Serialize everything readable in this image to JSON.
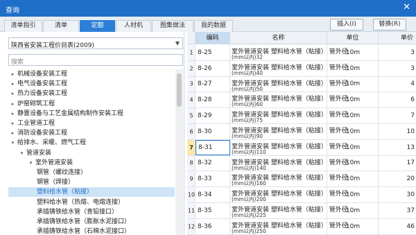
{
  "window": {
    "title": "查询",
    "close": "✕"
  },
  "tabs": [
    "清单指引",
    "清单",
    "定额",
    "人材机",
    "图集做法",
    "我的数据"
  ],
  "buttons": {
    "insert": "插入(I)",
    "replace": "替换(R)"
  },
  "library": {
    "selected": "陕西省安装工程价目表(2009)",
    "options_icon": "chevron-down-icon"
  },
  "search": {
    "placeholder": "搜索",
    "value": ""
  },
  "tree": [
    {
      "label": "机械设备安装工程",
      "twisty": "▸",
      "level": 0
    },
    {
      "label": "电气设备安装工程",
      "twisty": "▸",
      "level": 0
    },
    {
      "label": "热力设备安装工程",
      "twisty": "▸",
      "level": 0
    },
    {
      "label": "炉窑砌筑工程",
      "twisty": "▸",
      "level": 0
    },
    {
      "label": "静置设备与工艺金属结构制作安装工程",
      "twisty": "▸",
      "level": 0
    },
    {
      "label": "工业管道工程",
      "twisty": "▸",
      "level": 0
    },
    {
      "label": "消防设备安装工程",
      "twisty": "▸",
      "level": 0
    },
    {
      "label": "给排水、采暖、燃气工程",
      "twisty": "▾",
      "level": 0
    },
    {
      "label": "管道安装",
      "twisty": "▾",
      "level": 1
    },
    {
      "label": "室外管道安装",
      "twisty": "▾",
      "level": 2
    },
    {
      "label": "钢管（螺纹连接）",
      "twisty": "",
      "level": 3
    },
    {
      "label": "钢管（焊接）",
      "twisty": "",
      "level": 3
    },
    {
      "label": "塑料给水管（粘接）",
      "twisty": "",
      "level": 3,
      "selected": true
    },
    {
      "label": "塑料给水管（热熔、电熔连接）",
      "twisty": "",
      "level": 3
    },
    {
      "label": "承插铸铁给水管（青铅接口）",
      "twisty": "",
      "level": 3
    },
    {
      "label": "承插铸铁给水管（膨胀水泥接口）",
      "twisty": "",
      "level": 3
    },
    {
      "label": "承插铸铁给水管（石棉水泥接口）",
      "twisty": "",
      "level": 3
    },
    {
      "label": "承插铸铁给水管（胶圈接口）",
      "twisty": "",
      "level": 3
    }
  ],
  "grid": {
    "headers": {
      "code": "编码",
      "name": "名称",
      "unit": "单位",
      "price": "单价"
    },
    "current_row": 7,
    "rows": [
      {
        "n": "1",
        "code": "8-25",
        "name": "室外管道安装 塑料给水管（粘接） 管外径",
        "spec": "(mm以内)32",
        "unit": "10m",
        "price": "3"
      },
      {
        "n": "2",
        "code": "8-26",
        "name": "室外管道安装 塑料给水管（粘接） 管外径",
        "spec": "(mm以内)40",
        "unit": "10m",
        "price": "3"
      },
      {
        "n": "3",
        "code": "8-27",
        "name": "室外管道安装 塑料给水管（粘接） 管外径",
        "spec": "(mm以内)50",
        "unit": "10m",
        "price": "4"
      },
      {
        "n": "4",
        "code": "8-28",
        "name": "室外管道安装 塑料给水管（粘接） 管外径",
        "spec": "(mm以内)60",
        "unit": "10m",
        "price": "6"
      },
      {
        "n": "5",
        "code": "8-29",
        "name": "室外管道安装 塑料给水管（粘接） 管外径",
        "spec": "(mm以内)75",
        "unit": "10m",
        "price": "7"
      },
      {
        "n": "6",
        "code": "8-30",
        "name": "室外管道安装 塑料给水管（粘接） 管外径",
        "spec": "(mm以内)90",
        "unit": "10m",
        "price": "10"
      },
      {
        "n": "7",
        "code": "8-31",
        "name": "室外管道安装 塑料给水管（粘接） 管外径",
        "spec": "(mm以内)110",
        "unit": "10m",
        "price": "13"
      },
      {
        "n": "8",
        "code": "8-32",
        "name": "室外管道安装 塑料给水管（粘接） 管外径",
        "spec": "(mm以内)140",
        "unit": "10m",
        "price": "17"
      },
      {
        "n": "9",
        "code": "8-33",
        "name": "室外管道安装 塑料给水管（粘接） 管外径",
        "spec": "(mm以内)160",
        "unit": "10m",
        "price": "20"
      },
      {
        "n": "10",
        "code": "8-34",
        "name": "室外管道安装 塑料给水管（粘接） 管外径",
        "spec": "(mm以内)200",
        "unit": "10m",
        "price": "30"
      },
      {
        "n": "11",
        "code": "8-35",
        "name": "室外管道安装 塑料给水管（粘接） 管外径",
        "spec": "(mm以内)225",
        "unit": "10m",
        "price": "37"
      },
      {
        "n": "12",
        "code": "8-36",
        "name": "室外管道安装 塑料给水管（粘接） 管外径",
        "spec": "(mm以内)250",
        "unit": "10m",
        "price": "46"
      }
    ]
  },
  "colors": {
    "accent": "#1f6fc8",
    "selection": "#cfe3f7",
    "current_row": "#fbe8a8"
  }
}
